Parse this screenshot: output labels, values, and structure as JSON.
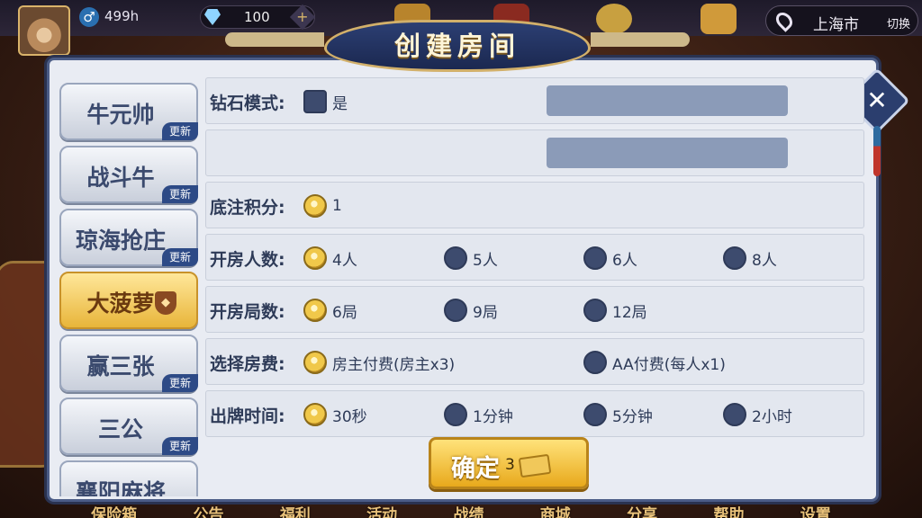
{
  "topbar": {
    "coins": "499h",
    "diamonds": "100",
    "plus": "+",
    "gender": "♂",
    "location_city": "上海市",
    "location_switch": "切换"
  },
  "dialog": {
    "title": "创建房间",
    "close": "✕"
  },
  "sidebar": {
    "items": [
      {
        "label": "牛元帅",
        "badge": "更新"
      },
      {
        "label": "战斗牛",
        "badge": "更新"
      },
      {
        "label": "琼海抢庄",
        "badge": "更新"
      },
      {
        "label": "大菠萝",
        "badge": ""
      },
      {
        "label": "赢三张",
        "badge": "更新"
      },
      {
        "label": "三公",
        "badge": "更新"
      },
      {
        "label": "襄阳麻将",
        "badge": ""
      }
    ]
  },
  "form": {
    "diamond_mode": {
      "label": "钻石模式:",
      "option": "是",
      "checked": false
    },
    "base_score": {
      "label": "底注积分:",
      "options": [
        "1"
      ],
      "selected": 0
    },
    "players": {
      "label": "开房人数:",
      "options": [
        "4人",
        "5人",
        "6人",
        "8人"
      ],
      "selected": 0
    },
    "rounds": {
      "label": "开房局数:",
      "options": [
        "6局",
        "9局",
        "12局"
      ],
      "selected": 0
    },
    "fee": {
      "label": "选择房费:",
      "options": [
        "房主付费(房主x3)",
        "AA付费(每人x1)"
      ],
      "selected": 0
    },
    "play_time": {
      "label": "出牌时间:",
      "options": [
        "30秒",
        "1分钟",
        "5分钟",
        "2小时"
      ],
      "selected": 0
    }
  },
  "confirm": {
    "label": "确定",
    "cost": "3",
    "cost_icon": "room-card-icon"
  },
  "bottom_nav": [
    "保险箱",
    "公告",
    "福利",
    "活动",
    "战绩",
    "商城",
    "分享",
    "帮助",
    "设置"
  ],
  "colors": {
    "accent_gold": "#f0c84a",
    "panel": "#e9ecf3",
    "navy": "#2b3e6e"
  }
}
